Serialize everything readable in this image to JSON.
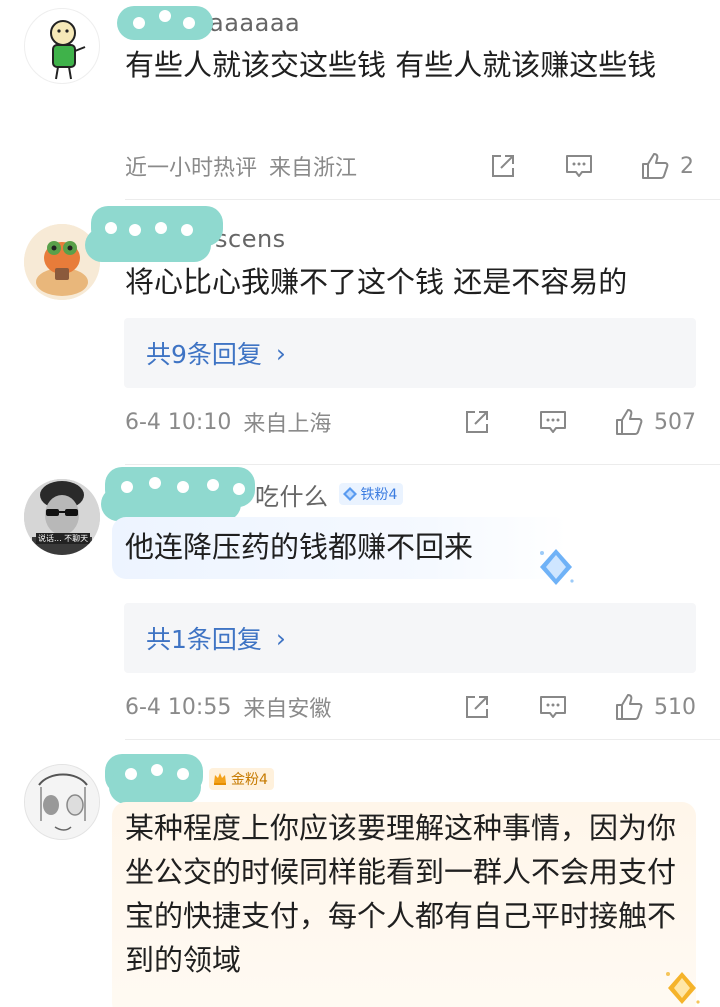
{
  "comments": [
    {
      "name_suffix": "aaaaaa",
      "badge": "",
      "text": "有些人就该交这些钱 有些人就该赚这些钱",
      "reply": "",
      "time": "近一小时热评",
      "location": "来自浙江",
      "likes": "2",
      "avatar_icon": "cartoon-avatar-icon"
    },
    {
      "name_suffix": "scens",
      "badge": "",
      "text": "将心比心我赚不了这个钱 还是不容易的",
      "reply": "共9条回复",
      "time": "6-4 10:10",
      "location": "来自上海",
      "likes": "507",
      "avatar_icon": "frog-avatar-icon"
    },
    {
      "name_suffix": "吃什么",
      "badge": "铁粉4",
      "text": "他连降压药的钱都赚不回来",
      "reply": "共1条回复",
      "time": "6-4 10:55",
      "location": "来自安徽",
      "likes": "510",
      "avatar_icon": "sunglasses-avatar-icon",
      "avatar_caption": "说话... 不聊天"
    },
    {
      "name_suffix": "",
      "badge": "金粉4",
      "text": "某种程度上你应该要理解这种事情，因为你坐公交的时候同样能看到一群人不会用支付宝的快捷支付，每个人都有自己平时接触不到的领域",
      "reply": "",
      "time": "",
      "location": "",
      "likes": "",
      "avatar_icon": "sketch-avatar-icon"
    }
  ],
  "colors": {
    "mask": "#8fd9cf",
    "reply_link": "#3f74c4",
    "meta": "#8a8a8a",
    "iron_badge": "#3b7ce0",
    "gold_badge": "#c67a00"
  },
  "icons": {
    "share": "share-icon",
    "reply": "comment-icon",
    "like": "thumbs-up-icon",
    "arrow": "chevron-right-icon"
  }
}
